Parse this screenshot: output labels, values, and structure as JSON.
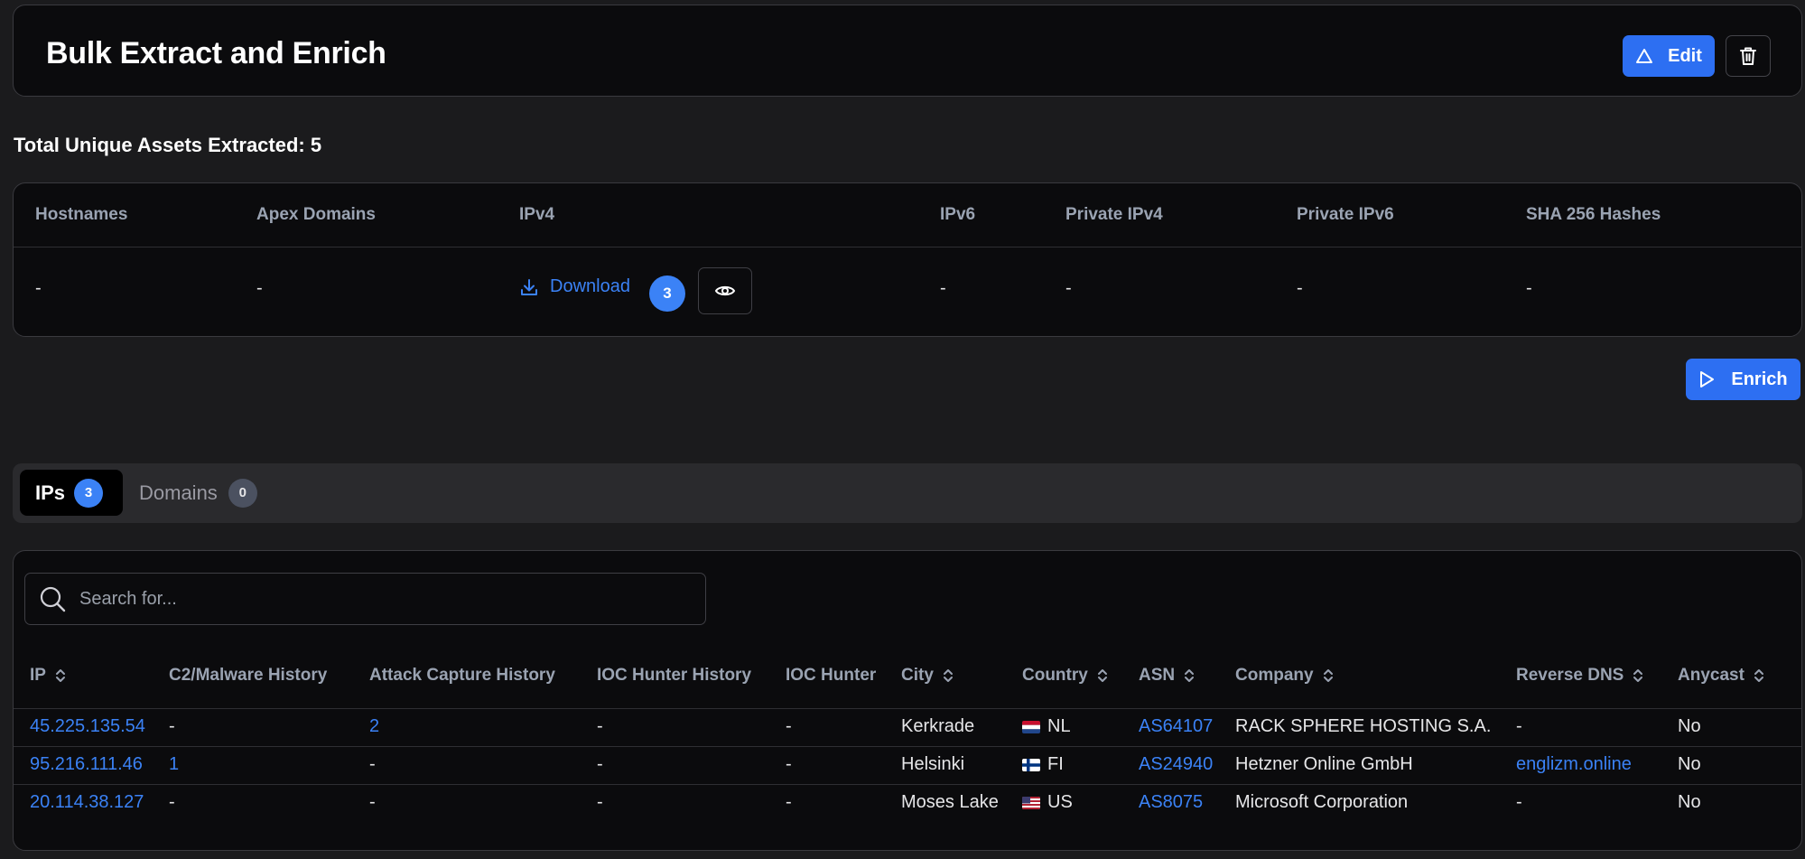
{
  "header": {
    "title": "Bulk Extract and Enrich",
    "edit_label": "Edit"
  },
  "summary": {
    "total_label": "Total Unique Assets Extracted: 5"
  },
  "extract_table": {
    "columns": [
      "Hostnames",
      "Apex Domains",
      "IPv4",
      "IPv6",
      "Private IPv4",
      "Private IPv6",
      "SHA 256 Hashes"
    ],
    "empty_value": "-",
    "download_label": "Download",
    "ipv4_count": "3"
  },
  "enrich": {
    "label": "Enrich"
  },
  "tabs": [
    {
      "label": "IPs",
      "count": "3"
    },
    {
      "label": "Domains",
      "count": "0"
    }
  ],
  "search": {
    "placeholder": "Search for..."
  },
  "ip_table": {
    "columns": [
      "IP",
      "C2/Malware History",
      "Attack Capture History",
      "IOC Hunter History",
      "IOC Hunter",
      "City",
      "Country",
      "ASN",
      "Company",
      "Reverse DNS",
      "Anycast"
    ],
    "rows": [
      {
        "ip": "45.225.135.54",
        "c2": "-",
        "attack": "2",
        "ioc_history": "-",
        "ioc_hunter": "-",
        "city": "Kerkrade",
        "country": "NL",
        "asn": "AS64107",
        "company": "RACK SPHERE HOSTING S.A.",
        "rdns": "-",
        "anycast": "No"
      },
      {
        "ip": "95.216.111.46",
        "c2": "1",
        "attack": "-",
        "ioc_history": "-",
        "ioc_hunter": "-",
        "city": "Helsinki",
        "country": "FI",
        "asn": "AS24940",
        "company": "Hetzner Online GmbH",
        "rdns": "englizm.online",
        "anycast": "No"
      },
      {
        "ip": "20.114.38.127",
        "c2": "-",
        "attack": "-",
        "ioc_history": "-",
        "ioc_hunter": "-",
        "city": "Moses Lake",
        "country": "US",
        "asn": "AS8075",
        "company": "Microsoft Corporation",
        "rdns": "-",
        "anycast": "No"
      }
    ]
  },
  "colors": {
    "accent": "#2d6ff2",
    "link": "#3b82f6",
    "background": "#1b1b1d",
    "panel": "#0b0b0d"
  },
  "icons": {
    "edit": "triangle-icon",
    "delete": "trash-icon",
    "download": "download-icon",
    "view": "eye-icon",
    "enrich": "play-icon",
    "search": "search-icon",
    "sort": "sort-icon"
  }
}
